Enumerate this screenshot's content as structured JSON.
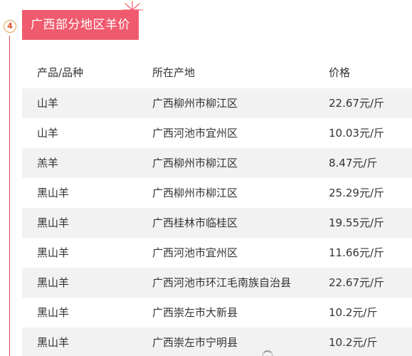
{
  "section": {
    "step_number": "4",
    "title": "广西部分地区羊价"
  },
  "table": {
    "headers": {
      "product": "产品/品种",
      "location": "所在产地",
      "price": "价格"
    },
    "rows": [
      {
        "product": "山羊",
        "location": "广西柳州市柳江区",
        "price": "22.67元/斤"
      },
      {
        "product": "山羊",
        "location": "广西河池市宜州区",
        "price": "10.03元/斤"
      },
      {
        "product": "羔羊",
        "location": "广西柳州市柳江区",
        "price": "8.47元/斤"
      },
      {
        "product": "黑山羊",
        "location": "广西柳州市柳江区",
        "price": "25.29元/斤"
      },
      {
        "product": "黑山羊",
        "location": "广西桂林市临桂区",
        "price": "19.55元/斤"
      },
      {
        "product": "黑山羊",
        "location": "广西河池市宜州区",
        "price": "11.66元/斤"
      },
      {
        "product": "黑山羊",
        "location": "广西河池市环江毛南族自治县",
        "price": "22.67元/斤"
      },
      {
        "product": "黑山羊",
        "location": "广西崇左市大新县",
        "price": "10.2元/斤"
      },
      {
        "product": "黑山羊",
        "location": "广西崇左市宁明县",
        "price": "10.2元/斤"
      }
    ]
  },
  "colors": {
    "accent": "#f05a6e",
    "timeline": "#d9534f",
    "row_shade": "#f2f2f2"
  },
  "icons": {
    "decoration": "firework-icon",
    "loading": "loading-spinner-icon"
  }
}
